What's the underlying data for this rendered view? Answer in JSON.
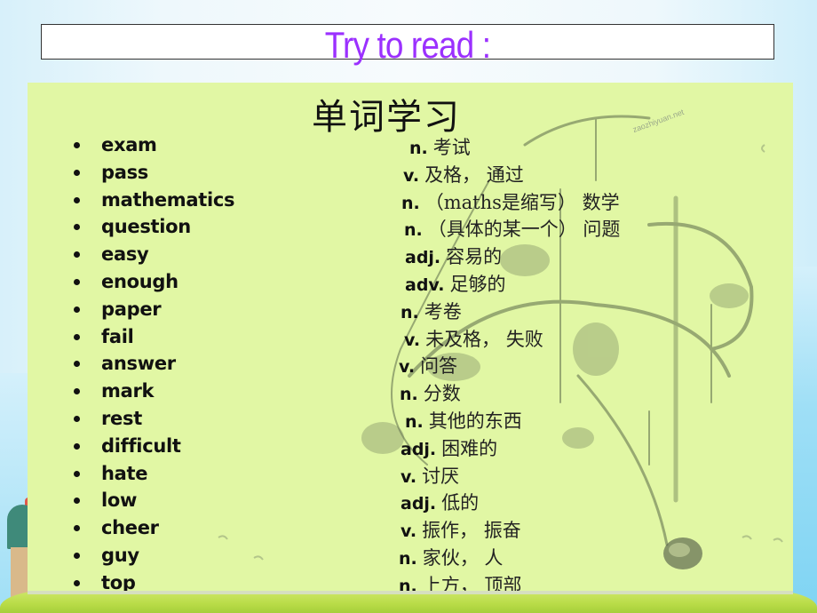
{
  "slide": {
    "title": "Try to read :",
    "heading": "单词学习",
    "watermark": "zaozhiyuan.net",
    "colors": {
      "title_text": "#9b30ff",
      "panel_bg": "#e1f7a4",
      "text": "#111111"
    }
  },
  "vocabulary": [
    {
      "word": "exam",
      "pos": "n.",
      "meaning": "考试"
    },
    {
      "word": "pass",
      "pos": "v.",
      "meaning": "及格， 通过"
    },
    {
      "word": "mathematics",
      "pos": "n.",
      "meaning": "（maths是缩写） 数学"
    },
    {
      "word": "question",
      "pos": "n.",
      "meaning": "（具体的某一个） 问题"
    },
    {
      "word": "easy",
      "pos": "adj.",
      "meaning": "容易的"
    },
    {
      "word": "enough",
      "pos": "adv.",
      "meaning": "足够的"
    },
    {
      "word": "paper",
      "pos": "n.",
      "meaning": "考卷"
    },
    {
      "word": "fail",
      "pos": "v.",
      "meaning": "未及格， 失败"
    },
    {
      "word": "answer",
      "pos": "v.",
      "meaning": "问答"
    },
    {
      "word": "mark",
      "pos": "n.",
      "meaning": "分数"
    },
    {
      "word": "rest",
      "pos": "n.",
      "meaning": "其他的东西"
    },
    {
      "word": "difficult",
      "pos": "adj.",
      "meaning": "困难的"
    },
    {
      "word": "hate",
      "pos": "v.",
      "meaning": "讨厌"
    },
    {
      "word": "low",
      "pos": "adj.",
      "meaning": "低的"
    },
    {
      "word": "cheer",
      "pos": "v.",
      "meaning": "振作， 振奋"
    },
    {
      "word": "guy",
      "pos": "n.",
      "meaning": "家伙， 人"
    },
    {
      "word": "top",
      "pos": "n.",
      "meaning": "上方， 顶部"
    }
  ]
}
